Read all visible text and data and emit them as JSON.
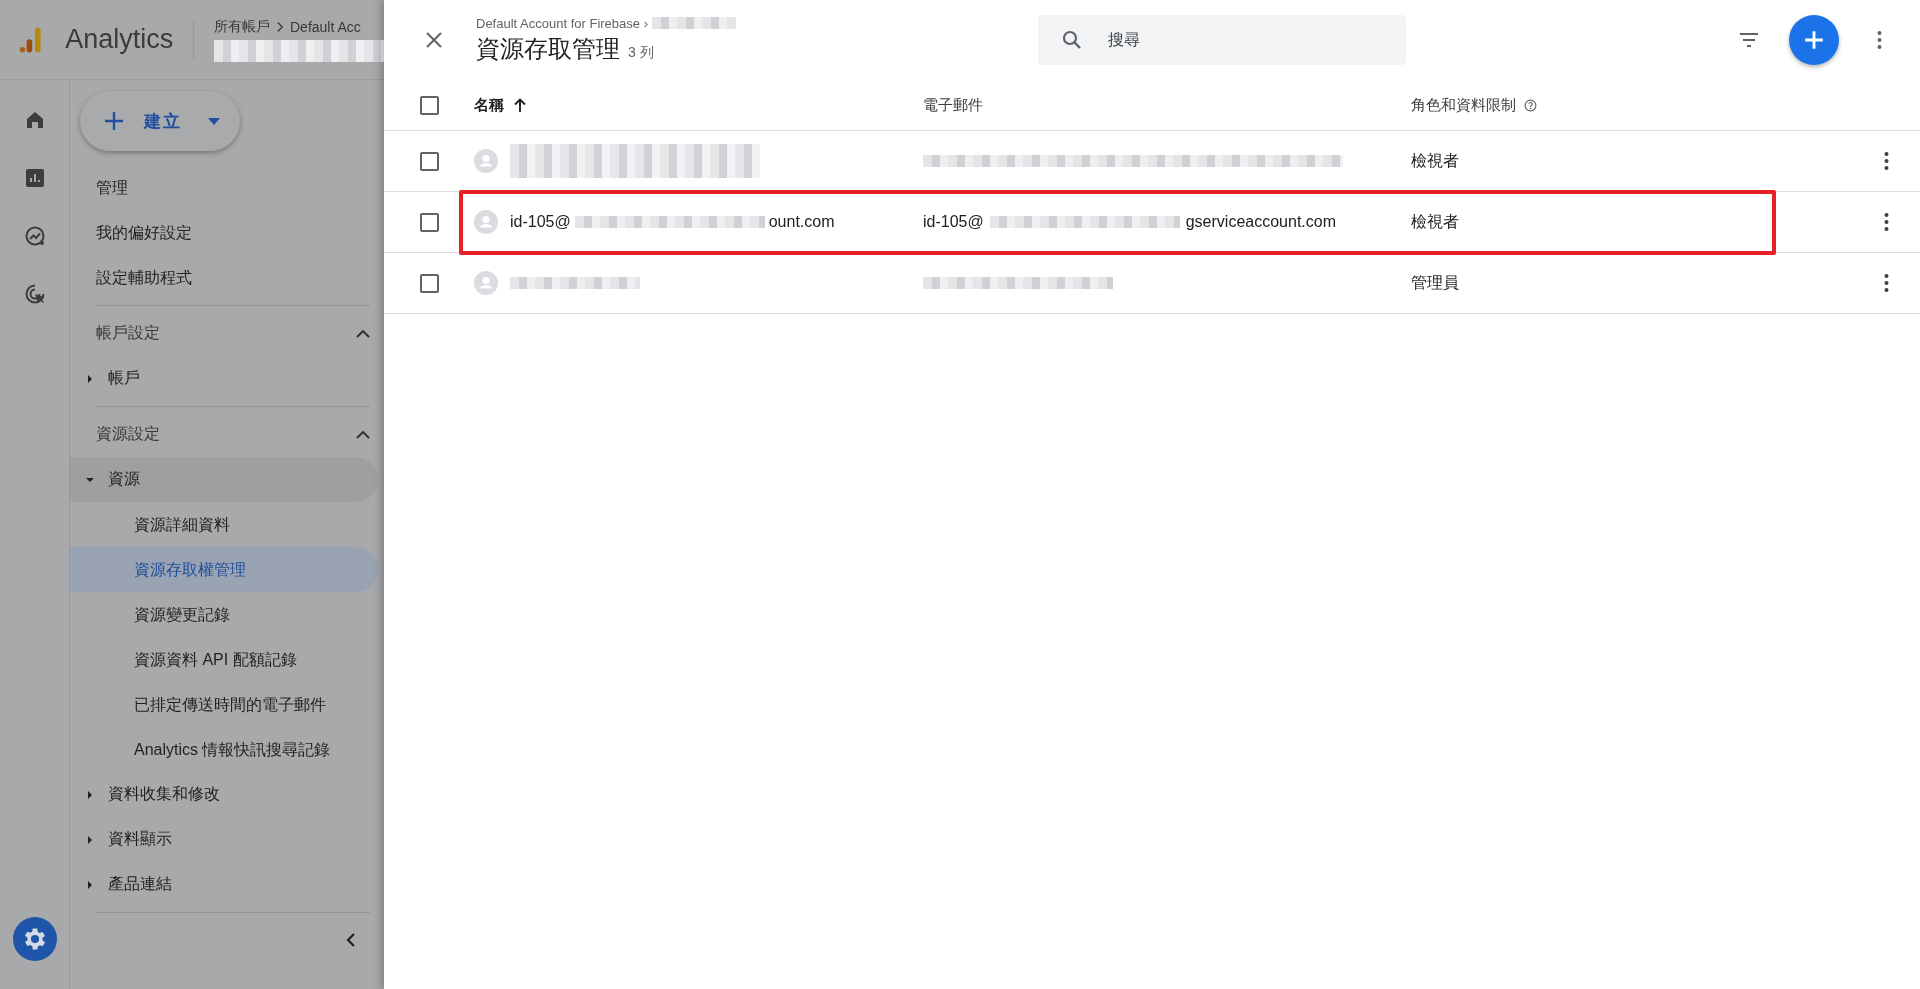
{
  "app_header": {
    "product": "Analytics",
    "breadcrumb": [
      "所有帳戶",
      "Default Acc"
    ]
  },
  "create_button": {
    "label": "建立"
  },
  "sidebar": {
    "links": [
      {
        "label": "管理"
      },
      {
        "label": "我的偏好設定"
      },
      {
        "label": "設定輔助程式"
      }
    ],
    "sections": [
      {
        "title": "帳戶設定",
        "expanded": true,
        "items": [
          {
            "label": "帳戶",
            "expanded": false
          }
        ]
      },
      {
        "title": "資源設定",
        "expanded": true,
        "items": [
          {
            "label": "資源",
            "expanded": true,
            "children": [
              {
                "label": "資源詳細資料",
                "selected": false
              },
              {
                "label": "資源存取權管理",
                "selected": true
              },
              {
                "label": "資源變更記錄",
                "selected": false
              },
              {
                "label": "資源資料 API 配額記錄",
                "selected": false
              },
              {
                "label": "已排定傳送時間的電子郵件",
                "selected": false
              },
              {
                "label": "Analytics 情報快訊搜尋記錄",
                "selected": false
              }
            ]
          },
          {
            "label": "資料收集和修改",
            "expanded": false
          },
          {
            "label": "資料顯示",
            "expanded": false
          },
          {
            "label": "產品連結",
            "expanded": false
          }
        ]
      }
    ]
  },
  "panel": {
    "breadcrumb": "Default Account for Firebase ›",
    "title": "資源存取管理",
    "count": "3 列",
    "search": {
      "placeholder": "搜尋"
    },
    "table": {
      "select_all": {
        "checked": false
      },
      "columns": [
        {
          "label": "名稱",
          "kind": "sorted"
        },
        {
          "label": "電子郵件",
          "kind": "plain"
        },
        {
          "label": "角色和資料限制",
          "kind": "help"
        }
      ],
      "rows": [
        {
          "checked": false,
          "highlighted": false,
          "name": [
            {
              "kind": "redacted_two_lines"
            }
          ],
          "email": [
            {
              "kind": "redacted_long"
            }
          ],
          "role": "檢視者"
        },
        {
          "checked": false,
          "highlighted": true,
          "name": [
            {
              "kind": "text",
              "text": "id-105@"
            },
            {
              "kind": "redacted_medium"
            },
            {
              "kind": "text",
              "text": "ount.com"
            }
          ],
          "email": [
            {
              "kind": "text",
              "text": "id-105@"
            },
            {
              "kind": "redacted_medium"
            },
            {
              "kind": "text",
              "text": "gserviceaccount.com"
            }
          ],
          "role": "檢視者"
        },
        {
          "checked": false,
          "highlighted": false,
          "name": [
            {
              "kind": "redacted_short"
            }
          ],
          "email": [
            {
              "kind": "redacted_medium"
            }
          ],
          "role": "管理員"
        }
      ]
    }
  }
}
